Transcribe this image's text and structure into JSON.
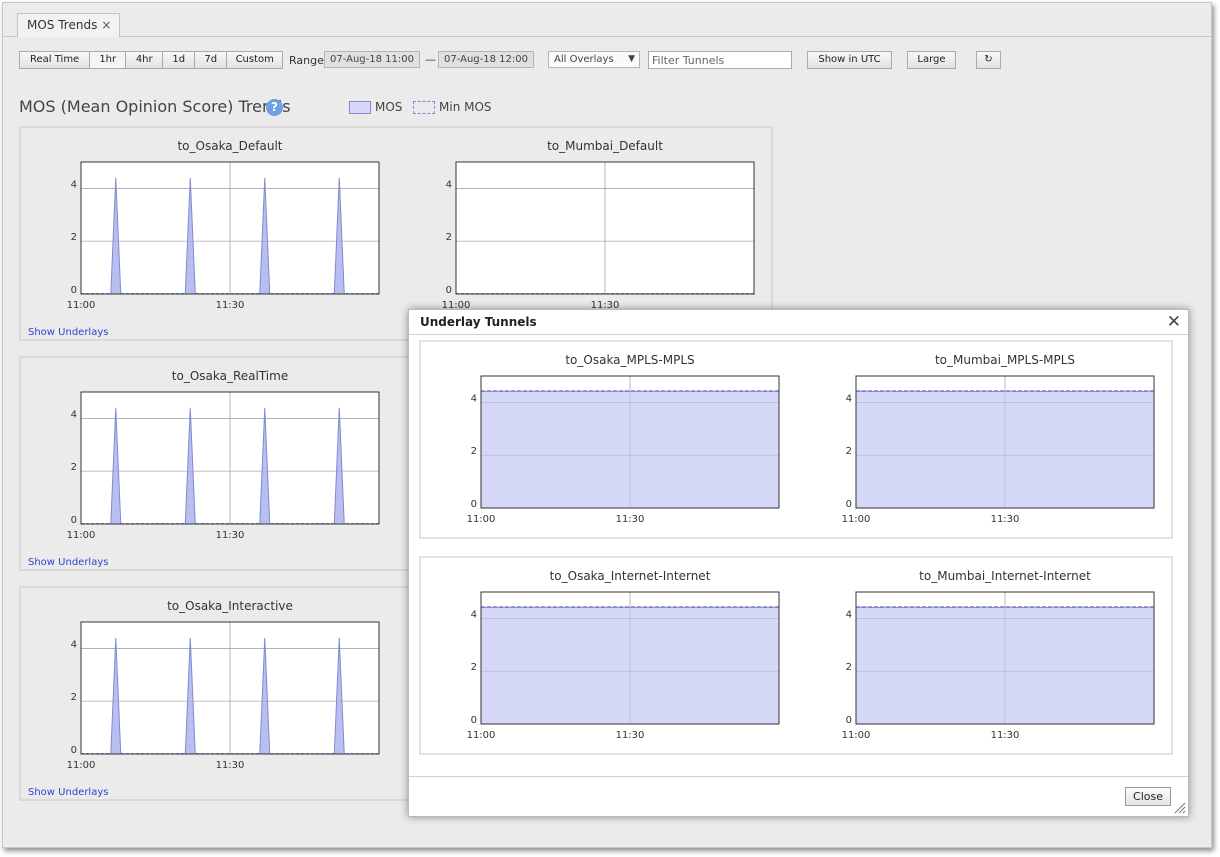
{
  "tab": {
    "title": "MOS Trends"
  },
  "toolbar": {
    "time_buttons": [
      "Real Time",
      "1hr",
      "4hr",
      "1d",
      "7d",
      "Custom"
    ],
    "range_label": "Range",
    "range_start": "07-Aug-18 11:00",
    "range_sep": "—",
    "range_end": "07-Aug-18 12:00",
    "overlays_value": "All Overlays",
    "filter_placeholder": "Filter Tunnels",
    "utc_label": "Show in UTC",
    "size_label": "Large"
  },
  "section": {
    "title": "MOS (Mean Opinion Score) Trends",
    "help": "?",
    "legend": {
      "mos": "MOS",
      "min_mos": "Min MOS"
    }
  },
  "panels": [
    {
      "link": "Show Underlays",
      "charts": [
        "to_Osaka_Default",
        "to_Mumbai_Default"
      ]
    },
    {
      "link": "Show Underlays",
      "charts": [
        "to_Osaka_RealTime"
      ]
    },
    {
      "link": "Show Underlays",
      "charts": [
        "to_Osaka_Interactive"
      ]
    }
  ],
  "dialog": {
    "title": "Underlay Tunnels",
    "close_label": "Close",
    "charts": [
      "to_Osaka_MPLS-MPLS",
      "to_Mumbai_MPLS-MPLS",
      "to_Osaka_Internet-Internet",
      "to_Mumbai_Internet-Internet"
    ]
  },
  "chart_data": [
    {
      "type": "area",
      "title": "to_Osaka_Default",
      "x": [
        "11:00",
        "11:30"
      ],
      "ylim": [
        0,
        5
      ],
      "yticks": [
        0,
        2,
        4
      ],
      "series": [
        {
          "name": "MOS",
          "peaks_at_minutes": [
            7,
            22,
            37,
            52
          ],
          "peak_value": 4.4,
          "base_value": 0
        }
      ]
    },
    {
      "type": "area",
      "title": "to_Mumbai_Default",
      "x": [
        "11:00",
        "11:30"
      ],
      "ylim": [
        0,
        5
      ],
      "yticks": [
        0,
        2,
        4
      ],
      "series": [
        {
          "name": "MOS",
          "constant_value": 0
        }
      ]
    },
    {
      "type": "area",
      "title": "to_Osaka_RealTime",
      "x": [
        "11:00",
        "11:30"
      ],
      "ylim": [
        0,
        5
      ],
      "yticks": [
        0,
        2,
        4
      ],
      "series": [
        {
          "name": "MOS",
          "peaks_at_minutes": [
            7,
            22,
            37,
            52
          ],
          "peak_value": 4.4,
          "base_value": 0
        }
      ]
    },
    {
      "type": "area",
      "title": "to_Osaka_Interactive",
      "x": [
        "11:00",
        "11:30"
      ],
      "ylim": [
        0,
        5
      ],
      "yticks": [
        0,
        2,
        4
      ],
      "series": [
        {
          "name": "MOS",
          "peaks_at_minutes": [
            7,
            22,
            37,
            52
          ],
          "peak_value": 4.4,
          "base_value": 0
        }
      ]
    },
    {
      "type": "area",
      "title": "to_Osaka_MPLS-MPLS",
      "x": [
        "11:00",
        "11:30"
      ],
      "ylim": [
        0,
        5
      ],
      "yticks": [
        0,
        2,
        4
      ],
      "series": [
        {
          "name": "MOS",
          "constant_value": 4.4
        },
        {
          "name": "Min MOS",
          "constant_value": 4.4
        }
      ]
    },
    {
      "type": "area",
      "title": "to_Mumbai_MPLS-MPLS",
      "x": [
        "11:00",
        "11:30"
      ],
      "ylim": [
        0,
        5
      ],
      "yticks": [
        0,
        2,
        4
      ],
      "series": [
        {
          "name": "MOS",
          "constant_value": 4.4
        },
        {
          "name": "Min MOS",
          "constant_value": 4.4
        }
      ]
    },
    {
      "type": "area",
      "title": "to_Osaka_Internet-Internet",
      "x": [
        "11:00",
        "11:30"
      ],
      "ylim": [
        0,
        5
      ],
      "yticks": [
        0,
        2,
        4
      ],
      "series": [
        {
          "name": "MOS",
          "constant_value": 4.4
        },
        {
          "name": "Min MOS",
          "constant_value": 4.4
        }
      ]
    },
    {
      "type": "area",
      "title": "to_Mumbai_Internet-Internet",
      "x": [
        "11:00",
        "11:30"
      ],
      "ylim": [
        0,
        5
      ],
      "yticks": [
        0,
        2,
        4
      ],
      "series": [
        {
          "name": "MOS",
          "constant_value": 4.4
        },
        {
          "name": "Min MOS",
          "constant_value": 4.4
        }
      ]
    }
  ],
  "colors": {
    "mos_fill": "#d5d9f7",
    "mos_line": "#7f8ad0",
    "link": "#2c46c9"
  }
}
